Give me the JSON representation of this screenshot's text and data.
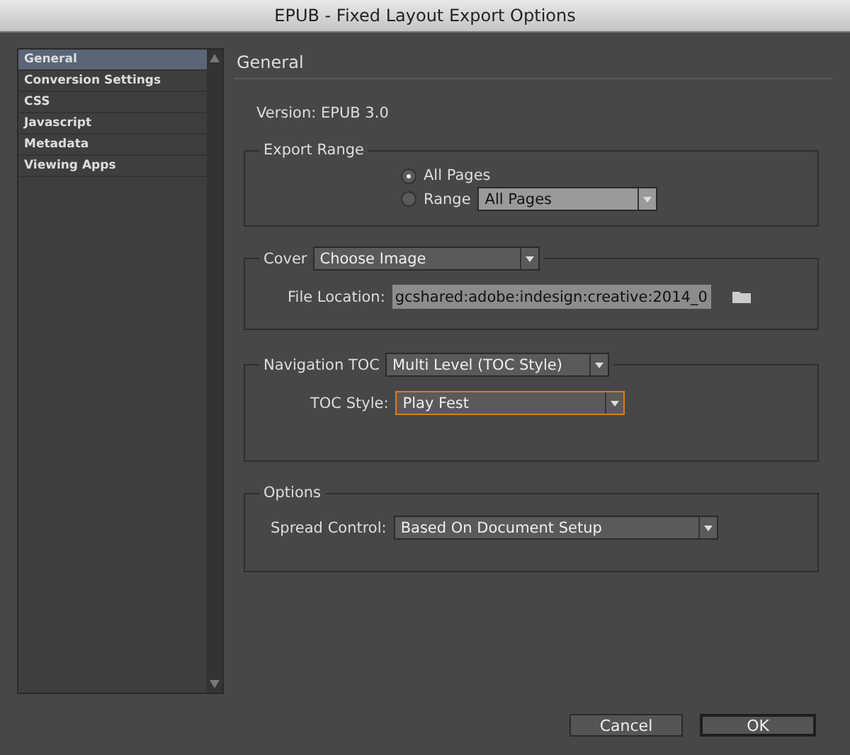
{
  "window": {
    "title": "EPUB - Fixed Layout Export Options"
  },
  "sidebar": {
    "items": [
      {
        "label": "General",
        "selected": true
      },
      {
        "label": "Conversion Settings",
        "selected": false
      },
      {
        "label": "CSS",
        "selected": false
      },
      {
        "label": "Javascript",
        "selected": false
      },
      {
        "label": "Metadata",
        "selected": false
      },
      {
        "label": "Viewing Apps",
        "selected": false
      }
    ]
  },
  "panel": {
    "heading": "General",
    "version": "Version: EPUB 3.0",
    "export_range": {
      "title": "Export Range",
      "options": [
        {
          "label": "All Pages",
          "selected": true
        },
        {
          "label": "Range",
          "selected": false
        }
      ],
      "range_value": "All Pages"
    },
    "cover": {
      "title": "Cover",
      "value": "Choose Image",
      "file_label": "File Location:",
      "file_value": "gcshared:adobe:indesign:creative:2014_0"
    },
    "navigation": {
      "title": "Navigation TOC",
      "value": "Multi Level (TOC Style)",
      "style_label": "TOC Style:",
      "style_value": "Play Fest",
      "style_focused": true
    },
    "options": {
      "title": "Options",
      "spread_label": "Spread Control:",
      "spread_value": "Based On Document Setup"
    }
  },
  "buttons": [
    {
      "label": "Cancel",
      "default": false
    },
    {
      "label": "OK",
      "default": true
    }
  ]
}
